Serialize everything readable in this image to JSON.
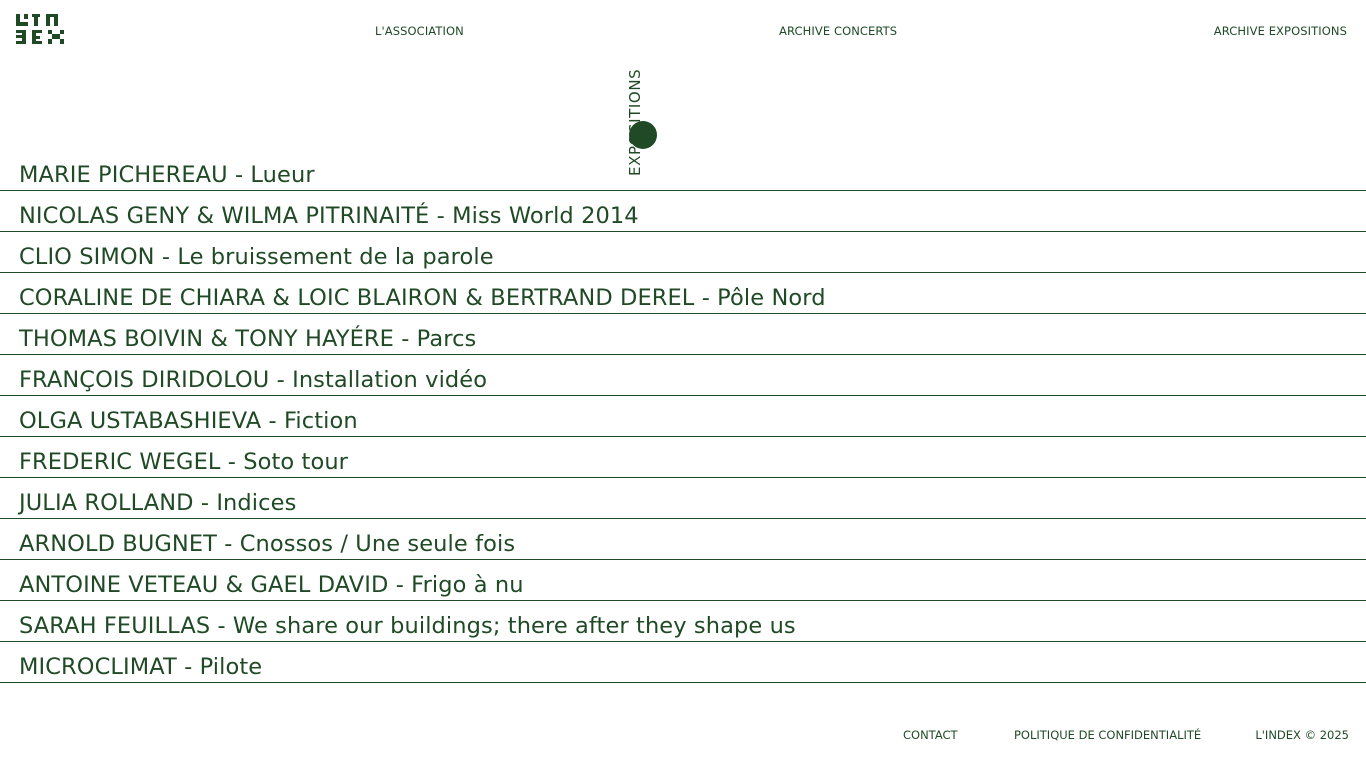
{
  "brand": {
    "logo_alt": "L'INDEX logo",
    "color": "#1f4a25"
  },
  "nav": {
    "association": "L'ASSOCIATION",
    "concerts": "ARCHIVE CONCERTS",
    "expositions": "ARCHIVE EXPOSITIONS"
  },
  "section": {
    "label": "EXPOSITIONS"
  },
  "exhibitions": [
    "MARIE PICHEREAU - Lueur",
    "NICOLAS GENY  & WILMA PITRINAITÉ - Miss World 2014",
    "CLIO SIMON - Le bruissement de la parole",
    "CORALINE DE CHIARA & LOIC BLAIRON & BERTRAND DEREL - Pôle Nord",
    "THOMAS BOIVIN & TONY HAYÉRE - Parcs",
    "FRANÇOIS DIRIDOLOU - Installation vidéo",
    "OLGA USTABASHIEVA - Fiction",
    "FREDERIC WEGEL - Soto tour",
    "JULIA ROLLAND - Indices",
    "ARNOLD BUGNET - Cnossos / Une seule fois",
    "ANTOINE VETEAU & GAEL DAVID - Frigo à nu",
    "SARAH FEUILLAS - We share our buildings; there after they shape us",
    "MICROCLIMAT - Pilote"
  ],
  "footer": {
    "contact": "CONTACT",
    "privacy": "POLITIQUE DE CONFIDENTIALITÉ",
    "copyright": "L'INDEX © 2025"
  }
}
